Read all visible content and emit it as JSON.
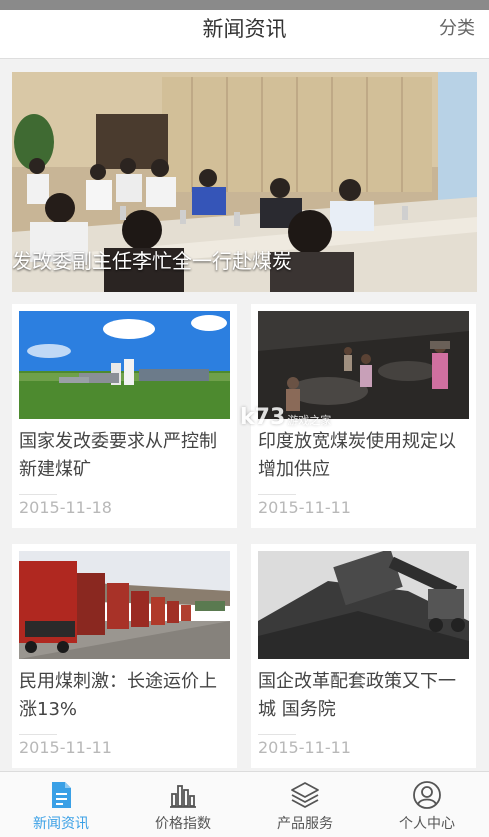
{
  "header": {
    "title": "新闻资讯",
    "right_action": "分类"
  },
  "hero": {
    "caption": "发改委副主任李忙全一行赴煤炭"
  },
  "news": [
    {
      "title": "国家发改委要求从严控制新建煤矿",
      "date": "2015-11-18",
      "image": "industrial-plant-grassland"
    },
    {
      "title": "印度放宽煤炭使用规定以增加供应",
      "date": "2015-11-11",
      "image": "coal-workers"
    },
    {
      "title": "民用煤刺激：长途运价上涨13%",
      "date": "2015-11-11",
      "image": "coal-trucks"
    },
    {
      "title": "国企改革配套政策又下一城 国务院",
      "date": "2015-11-11",
      "image": "coal-pile-excavator"
    }
  ],
  "watermark": {
    "text": "k73",
    "sub": "游戏之家"
  },
  "tabbar": {
    "items": [
      {
        "label": "新闻资讯",
        "icon": "document-icon",
        "active": true
      },
      {
        "label": "价格指数",
        "icon": "bar-chart-icon",
        "active": false
      },
      {
        "label": "产品服务",
        "icon": "layers-icon",
        "active": false
      },
      {
        "label": "个人中心",
        "icon": "user-icon",
        "active": false
      }
    ]
  },
  "colors": {
    "accent": "#3aa0e6",
    "background": "#f2f2f2",
    "date": "#b8b8b8"
  }
}
